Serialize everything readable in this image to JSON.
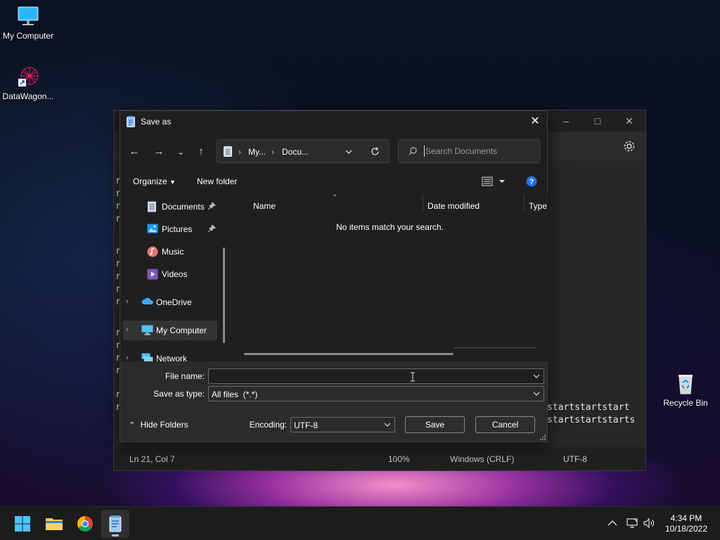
{
  "desktop": {
    "icons": [
      {
        "label": "My Computer",
        "icon": "computer-monitor-icon"
      },
      {
        "label": "DataWagon...",
        "icon": "datawagon-shortcut-icon"
      },
      {
        "label": "Recycle Bin",
        "icon": "recycle-bin-icon"
      }
    ]
  },
  "notepad": {
    "editor_lines": [
      "r",
      "r",
      "r",
      "r",
      "r",
      "r",
      "r",
      "r",
      "r",
      "r",
      "r",
      "r",
      "r",
      "r",
      "r"
    ],
    "tail_line_1": "startstartstart",
    "tail_line_2": "startstartstarts",
    "status": {
      "position": "Ln 21, Col 7",
      "zoom": "100%",
      "line_ending": "Windows (CRLF)",
      "encoding": "UTF-8"
    }
  },
  "dialog": {
    "title": "Save as",
    "address": {
      "seg1": "My...",
      "seg2": "Docu..."
    },
    "search_placeholder": "Search Documents",
    "commands": {
      "organize": "Organize",
      "new_folder": "New folder"
    },
    "nav": {
      "documents": "Documents",
      "pictures": "Pictures",
      "music": "Music",
      "videos": "Videos",
      "onedrive": "OneDrive",
      "my_computer": "My Computer",
      "network": "Network"
    },
    "columns": {
      "name": "Name",
      "date_modified": "Date modified",
      "type": "Type"
    },
    "empty_message": "No items match your search.",
    "form": {
      "file_name_label": "File name:",
      "file_name_value": "",
      "save_type_label": "Save as type:",
      "save_type_value": "All files  (*.*)",
      "encoding_label": "Encoding:",
      "encoding_value": "UTF-8",
      "hide_folders": "Hide Folders",
      "save": "Save",
      "cancel": "Cancel"
    }
  },
  "taskbar": {
    "time": "4:34 PM",
    "date": "10/18/2022"
  },
  "colors": {
    "accent": "#0078d4",
    "dialog_bg": "#2b2b2b",
    "pane_bg": "#1f1f1f"
  }
}
